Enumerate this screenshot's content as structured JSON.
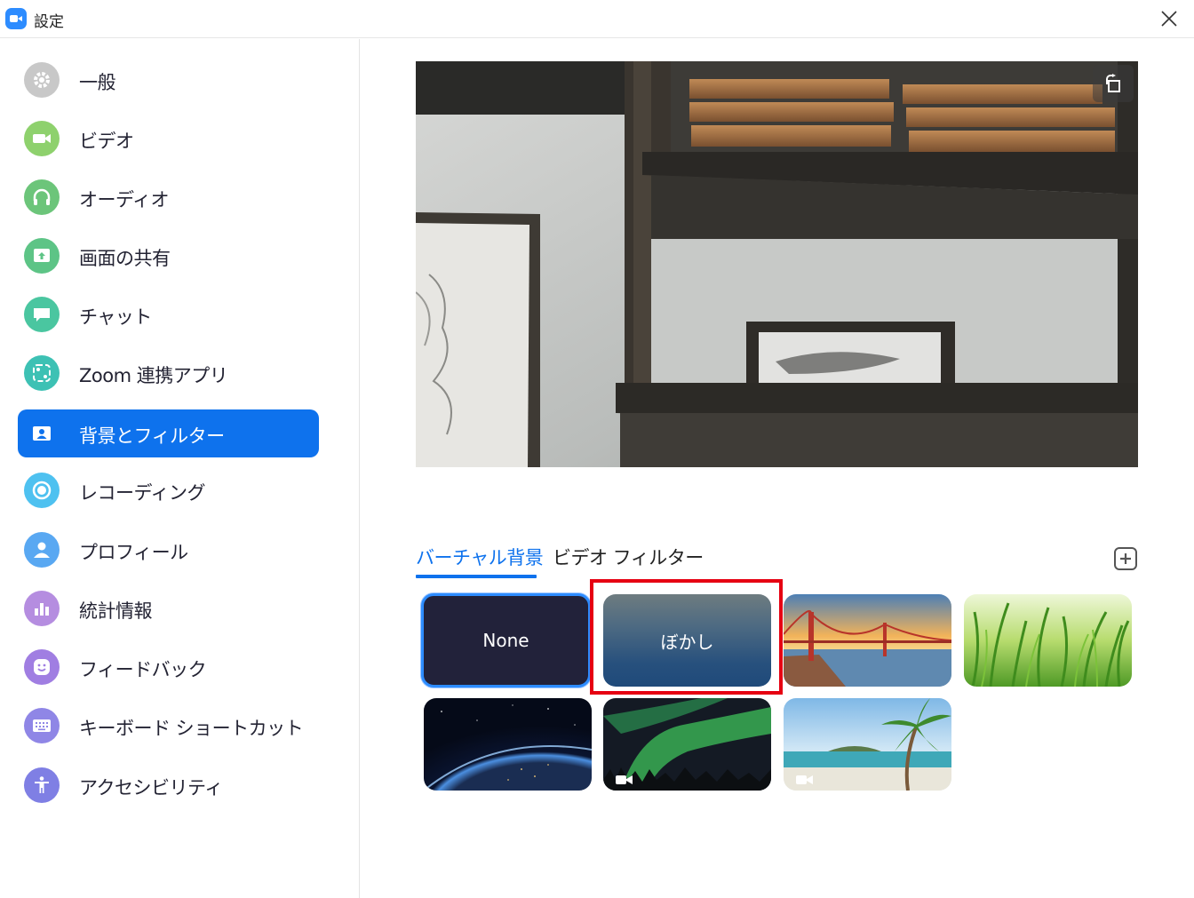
{
  "window": {
    "title": "設定",
    "close_icon": "close-icon",
    "logo_icon": "zoom-logo-icon"
  },
  "sidebar": {
    "items": [
      {
        "label": "一般",
        "icon": "gear-icon",
        "color": "#c8c8c8",
        "active": false
      },
      {
        "label": "ビデオ",
        "icon": "video-camera-icon",
        "color": "#8ed16d",
        "active": false
      },
      {
        "label": "オーディオ",
        "icon": "headphones-icon",
        "color": "#6cc57a",
        "active": false
      },
      {
        "label": "画面の共有",
        "icon": "share-screen-icon",
        "color": "#5dc486",
        "active": false
      },
      {
        "label": "チャット",
        "icon": "chat-bubble-icon",
        "color": "#4ac6a0",
        "active": false
      },
      {
        "label": "Zoom 連携アプリ",
        "icon": "apps-icon",
        "color": "#3dc1b4",
        "active": false
      },
      {
        "label": "背景とフィルター",
        "icon": "person-card-icon",
        "color": "#0e72ed",
        "active": true
      },
      {
        "label": "レコーディング",
        "icon": "record-icon",
        "color": "#4ec1f0",
        "active": false
      },
      {
        "label": "プロフィール",
        "icon": "profile-icon",
        "color": "#59a8f2",
        "active": false
      },
      {
        "label": "統計情報",
        "icon": "statistics-icon",
        "color": "#b58de0",
        "active": false
      },
      {
        "label": "フィードバック",
        "icon": "smiley-icon",
        "color": "#a07ee2",
        "active": false
      },
      {
        "label": "キーボード ショートカット",
        "icon": "keyboard-icon",
        "color": "#8f86e6",
        "active": false
      },
      {
        "label": "アクセシビリティ",
        "icon": "accessibility-icon",
        "color": "#7f7fe4",
        "active": false
      }
    ]
  },
  "preview": {
    "rotate_icon": "rotate-camera-icon"
  },
  "tabs": [
    {
      "label": "バーチャル背景",
      "active": true
    },
    {
      "label": "ビデオ フィルター",
      "active": false
    }
  ],
  "add_button_icon": "plus-square-icon",
  "backgrounds": [
    {
      "label": "None",
      "selected": true
    },
    {
      "label": "ぼかし",
      "selected": false,
      "highlighted": true
    },
    {
      "label": "",
      "scene": "golden-gate-bridge"
    },
    {
      "label": "",
      "scene": "grass"
    },
    {
      "label": "",
      "scene": "earth-from-space"
    },
    {
      "label": "",
      "scene": "aurora",
      "video": true
    },
    {
      "label": "",
      "scene": "beach-palm",
      "video": true
    }
  ],
  "colors": {
    "accent": "#0e72ed",
    "highlight_border": "#e60012"
  }
}
